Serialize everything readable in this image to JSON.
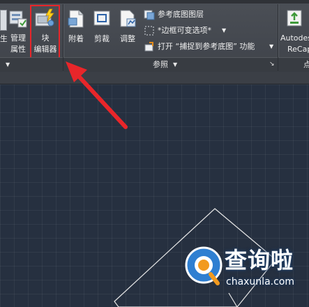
{
  "ribbon": {
    "edge_left_label_line1": "生",
    "manage_button": {
      "line1": "管理",
      "line2": "属性"
    },
    "block_editor_button": {
      "line1": "块",
      "line2": "编辑器"
    },
    "attach_button": "附着",
    "clip_button": "剪裁",
    "adjust_button": "调整",
    "reference_layer_row": "参考底图图层",
    "frame_variable_row": "*边框可变选项*",
    "snap_toggle_row": "打开 “捕捉到参考底图” 功能",
    "recap_button": {
      "line1": "Autodesk",
      "line2": "ReCap"
    },
    "reference_panel_title": "参照",
    "right_panel_title_fragment": "点"
  },
  "annotations": {
    "highlight_color": "#e8262a",
    "arrow_color": "#e8262a"
  },
  "watermark": {
    "brand_cn": "查询啦",
    "domain": "chaxunla.com"
  },
  "colors": {
    "canvas_bg": "#263040",
    "ribbon_bg": "#44484f",
    "shape_stroke": "#e6e6e6"
  }
}
